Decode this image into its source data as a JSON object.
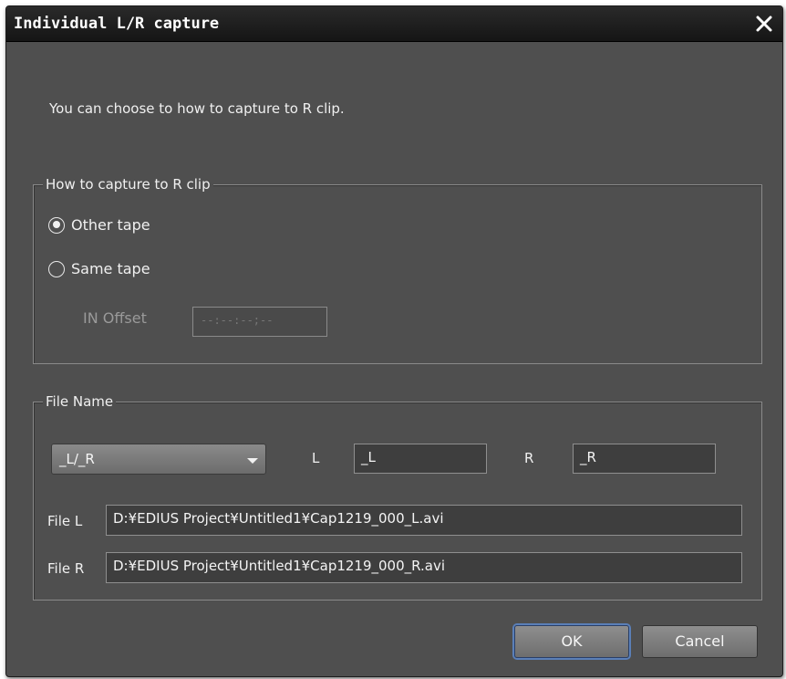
{
  "window": {
    "title": "Individual L/R capture"
  },
  "intro_text": "You can choose to how to capture to R clip.",
  "capture_group": {
    "legend": "How to capture to R clip",
    "options": [
      {
        "label": "Other tape",
        "checked": true
      },
      {
        "label": "Same tape",
        "checked": false
      }
    ],
    "in_offset_label": "IN Offset",
    "in_offset_value": "--:--:--;--"
  },
  "file_name_group": {
    "legend": "File Name",
    "suffix_mode": "_L/_R",
    "l_label": "L",
    "l_value": "_L",
    "r_label": "R",
    "r_value": "_R",
    "file_l_label": "File L",
    "file_l_value": "D:¥EDIUS Project¥Untitled1¥Cap1219_000_L.avi",
    "file_r_label": "File R",
    "file_r_value": "D:¥EDIUS Project¥Untitled1¥Cap1219_000_R.avi"
  },
  "buttons": {
    "ok": "OK",
    "cancel": "Cancel"
  },
  "colors": {
    "background": "#4f4f4f",
    "titlebar": "#151515",
    "default_button_ring": "#5a7fb8"
  }
}
